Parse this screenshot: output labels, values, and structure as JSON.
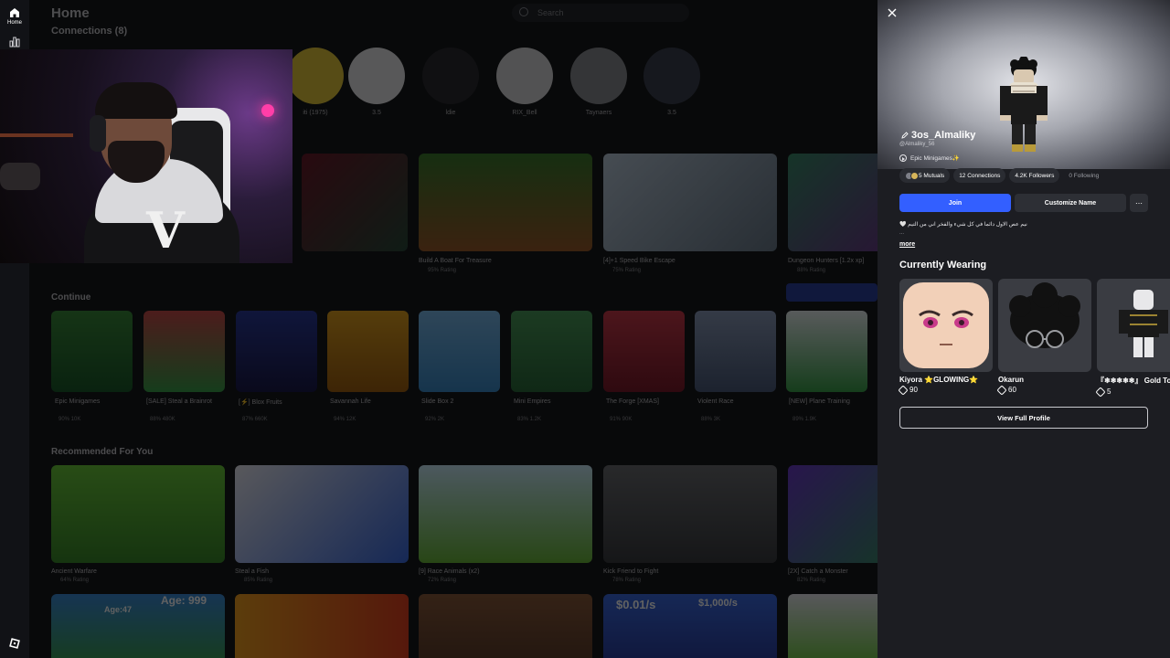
{
  "rail": {
    "home_label": "Home"
  },
  "background": {
    "title": "Home",
    "connections_label": "Connections (8)",
    "search_placeholder": "Search",
    "friends": [
      "iti (1975)",
      "3.5",
      "ldie",
      "RIX_Bell",
      "Taynaers",
      "3.5"
    ],
    "sections": {
      "continue": "Continue",
      "recommended": "Recommended For You"
    },
    "top_row": [
      {
        "name": "Build A Boat For Treasure",
        "sub": "95% Rating"
      },
      {
        "name": "[4]+1 Speed Bike Escape",
        "sub": "75% Rating"
      },
      {
        "name": "Dungeon Hunters [1.2x xp]",
        "sub": "88% Rating"
      }
    ],
    "continue_row": [
      {
        "name": "Epic Minigames",
        "sub": "90%  10K"
      },
      {
        "name": "[SALE] Steal a Brainrot",
        "sub": "88%  480K"
      },
      {
        "name": "[⚡] Blox Fruits",
        "sub": "87%  660K"
      },
      {
        "name": "Savannah Life",
        "sub": "94%  12K"
      },
      {
        "name": "Slide Box 2",
        "sub": "92%  2K"
      },
      {
        "name": "Mini Empires",
        "sub": "83%  1.2K"
      },
      {
        "name": "The Forge [XMAS]",
        "sub": "91%  90K"
      },
      {
        "name": "Violent Race",
        "sub": "88%  3K"
      },
      {
        "name": "[NEW] Plane Training",
        "sub": "89%  1.9K"
      }
    ],
    "recommended_row": [
      {
        "name": "Ancient Warfare",
        "sub": "64% Rating"
      },
      {
        "name": "Steal a Fish",
        "sub": "85% Rating"
      },
      {
        "name": "[9] Race Animals (x2)",
        "sub": "72% Rating"
      },
      {
        "name": "Kick Friend to Fight",
        "sub": "78% Rating"
      },
      {
        "name": "[2X] Catch a Monster",
        "sub": "82% Rating"
      }
    ],
    "bottom_labels": {
      "age_left": "Age:47",
      "age_right": "Age: 999",
      "price_a": "$0.01/s",
      "price_b": "$1,000/s"
    }
  },
  "profile": {
    "display_name": "3os_Almaliky",
    "username": "@Almaliky_56",
    "playing": "Epic Minigames✨",
    "stats": {
      "mutuals": "5 Mutuals",
      "connections": "12 Connections",
      "followers": "4.2K Followers",
      "following": "0 Following"
    },
    "join_label": "Join",
    "customize_label": "Customize Name",
    "more_btn": "⋯",
    "bio": "نيم عص الاول دائما في كل شيء والفخر اني من التيم 🤍",
    "bio_ellipsis": "...",
    "more_link": "more",
    "wearing_title": "Currently Wearing",
    "wearing": [
      {
        "name": "Kiyora ⭐GLOWING⭐",
        "price": "90"
      },
      {
        "name": "Okarun",
        "price": "60"
      },
      {
        "name": "『❄❄❄❄❄』 Gold Toon",
        "price": "5"
      }
    ],
    "view_full_label": "View Full Profile"
  },
  "colors": {
    "accent": "#335fff",
    "panel_bg": "#1c1d22"
  }
}
